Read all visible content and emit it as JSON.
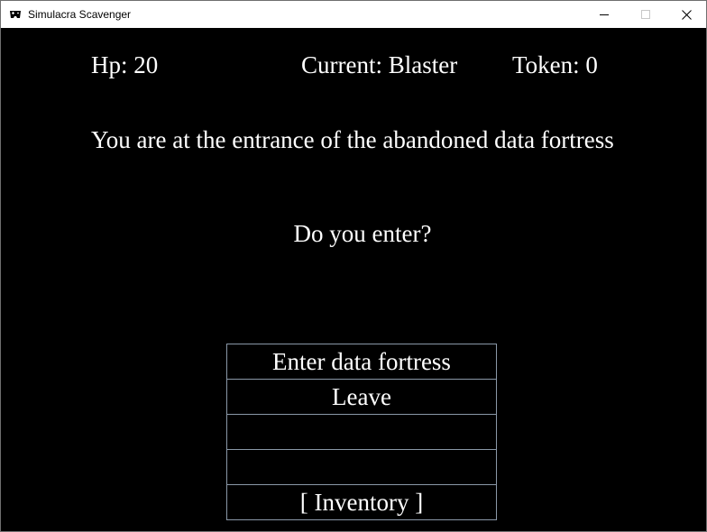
{
  "window": {
    "title": "Simulacra Scavenger",
    "app_icon": "gamepad-icon",
    "controls": [
      "minimize-icon",
      "maximize-icon",
      "close-icon"
    ]
  },
  "status": {
    "hp": "Hp: 20",
    "current": "Current: Blaster",
    "token": "Token: 0"
  },
  "scene": {
    "description": "You are at the entrance of the abandoned data fortress",
    "question": "Do you enter?"
  },
  "options": [
    {
      "label": "Enter data fortress"
    },
    {
      "label": "Leave"
    },
    {
      "label": ""
    },
    {
      "label": ""
    },
    {
      "label": "[ Inventory ]"
    }
  ]
}
